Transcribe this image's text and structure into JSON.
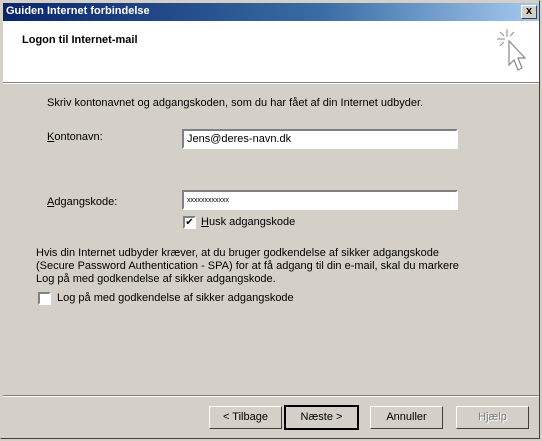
{
  "window": {
    "title": "Guiden Internet forbindelse",
    "close_label": "x"
  },
  "header": {
    "heading": "Logon til Internet-mail"
  },
  "intro": "Skriv kontonavnet og adgangskoden, som du har fået af din Internet udbyder.",
  "account": {
    "label": "Kontonavn:",
    "value": "Jens@deres-navn.dk"
  },
  "password": {
    "label": "Adgangskode:",
    "value": "xxxxxxxxxxxx"
  },
  "remember": {
    "label": "Husk adgangskode",
    "checked": true
  },
  "spa": {
    "line1": "Hvis din Internet udbyder kræver, at du bruger godkendelse af sikker adgangskode",
    "line2": "(Secure Password Authentication - SPA) for at få adgang til din e-mail, skal du markere",
    "line3": "Log på med godkendelse af sikker adgangskode.",
    "checkbox_label": "Log på med godkendelse af sikker adgangskode",
    "checked": false
  },
  "buttons": {
    "back": "< Tilbage",
    "next": "Næste >",
    "cancel": "Annuller",
    "help": "Hjælp"
  }
}
